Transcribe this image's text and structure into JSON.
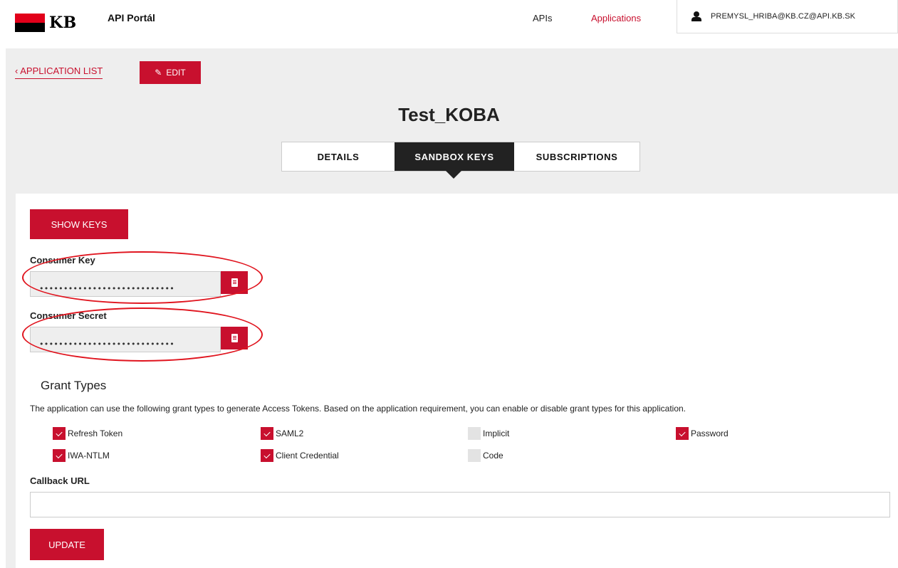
{
  "header": {
    "logo_text": "KB",
    "portal_name": "API Portál",
    "nav": {
      "apis": "APIs",
      "applications": "Applications"
    },
    "user_email": "PREMYSL_HRIBA@KB.CZ@API.KB.SK"
  },
  "toolbar": {
    "back_label": "APPLICATION LIST",
    "back_icon": "chevron-left-icon",
    "edit_label": "EDIT",
    "edit_icon": "pencil-icon"
  },
  "app": {
    "title": "Test_KOBA",
    "tabs": [
      {
        "label": "DETAILS",
        "active": false
      },
      {
        "label": "SANDBOX KEYS",
        "active": true
      },
      {
        "label": "SUBSCRIPTIONS",
        "active": false
      }
    ]
  },
  "keys": {
    "show_keys_label": "SHOW KEYS",
    "consumer_key": {
      "label": "Consumer Key",
      "value": "••••••••••••••••••••••••••••"
    },
    "consumer_secret": {
      "label": "Consumer Secret",
      "value": "••••••••••••••••••••••••••••"
    },
    "copy_icon": "clipboard-icon"
  },
  "grant_types": {
    "title": "Grant Types",
    "description": "The application can use the following grant types to generate Access Tokens. Based on the application requirement, you can enable or disable grant types for this application.",
    "items": [
      {
        "label": "Refresh Token",
        "checked": true
      },
      {
        "label": "SAML2",
        "checked": true
      },
      {
        "label": "Implicit",
        "checked": false
      },
      {
        "label": "Password",
        "checked": true
      },
      {
        "label": "IWA-NTLM",
        "checked": true
      },
      {
        "label": "Client Credential",
        "checked": true
      },
      {
        "label": "Code",
        "checked": false
      }
    ]
  },
  "callback": {
    "label": "Callback URL",
    "value": ""
  },
  "update_label": "UPDATE",
  "colors": {
    "accent": "#c8102e",
    "band": "#eeeeee",
    "annotation": "#e0141e"
  }
}
